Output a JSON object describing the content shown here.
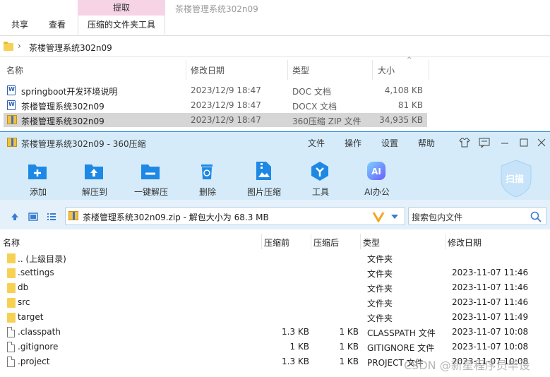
{
  "ribbon": {
    "contextual_tab": "提取",
    "tabs": [
      "共享",
      "查看",
      "压缩的文件夹工具"
    ],
    "window_title": "茶楼管理系统302n09"
  },
  "address": {
    "separator": "›",
    "path": "茶楼管理系统302n09"
  },
  "explorer": {
    "columns": [
      "名称",
      "修改日期",
      "类型",
      "大小"
    ],
    "files": [
      {
        "name": "springboot开发环境说明",
        "date": "2023/12/9 18:47",
        "type": "DOC 文档",
        "size": "4,108 KB",
        "icon": "word-doc-icon"
      },
      {
        "name": "茶楼管理系统302n09",
        "date": "2023/12/9 18:47",
        "type": "DOCX 文档",
        "size": "81 KB",
        "icon": "word-doc-icon"
      },
      {
        "name": "茶楼管理系统302n09",
        "date": "2023/12/9 18:47",
        "type": "360压缩 ZIP 文件",
        "size": "34,935 KB",
        "icon": "zip-icon"
      }
    ]
  },
  "zip": {
    "title": "茶楼管理系统302n09 - 360压缩",
    "menu": [
      "文件",
      "操作",
      "设置",
      "帮助"
    ],
    "tools": [
      {
        "label": "添加",
        "icon": "add-icon"
      },
      {
        "label": "解压到",
        "icon": "extract-to-icon"
      },
      {
        "label": "一键解压",
        "icon": "one-click-extract-icon"
      },
      {
        "label": "删除",
        "icon": "delete-icon"
      },
      {
        "label": "图片压缩",
        "icon": "image-compress-icon"
      },
      {
        "label": "工具",
        "icon": "tools-icon"
      },
      {
        "label": "AI办公",
        "icon": "ai-office-icon"
      }
    ],
    "scan_label": "扫描",
    "path_text": "茶楼管理系统302n09.zip - 解包大小为 68.3 MB",
    "search_placeholder": "搜索包内文件",
    "columns": [
      "名称",
      "压缩前",
      "压缩后",
      "类型",
      "修改日期"
    ],
    "rows": [
      {
        "name": ".. (上级目录)",
        "before": "",
        "after": "",
        "type": "文件夹",
        "date": "",
        "kind": "folder"
      },
      {
        "name": ".settings",
        "before": "",
        "after": "",
        "type": "文件夹",
        "date": "2023-11-07 11:46",
        "kind": "folder"
      },
      {
        "name": "db",
        "before": "",
        "after": "",
        "type": "文件夹",
        "date": "2023-11-07 11:46",
        "kind": "folder"
      },
      {
        "name": "src",
        "before": "",
        "after": "",
        "type": "文件夹",
        "date": "2023-11-07 11:46",
        "kind": "folder"
      },
      {
        "name": "target",
        "before": "",
        "after": "",
        "type": "文件夹",
        "date": "2023-11-07 11:49",
        "kind": "folder"
      },
      {
        "name": ".classpath",
        "before": "1.3 KB",
        "after": "1 KB",
        "type": "CLASSPATH 文件",
        "date": "2023-11-07 10:08",
        "kind": "file"
      },
      {
        "name": ".gitignore",
        "before": "1 KB",
        "after": "1 KB",
        "type": "GITIGNORE 文件",
        "date": "2023-11-07 10:08",
        "kind": "file"
      },
      {
        "name": ".project",
        "before": "1.3 KB",
        "after": "1 KB",
        "type": "PROJECT 文件",
        "date": "2023-11-07 10:08",
        "kind": "file"
      }
    ]
  },
  "watermark": "CSDN @新星程序员毕设",
  "colors": {
    "accent": "#1e88e5",
    "titlebar": "#d5ebfa",
    "pink_tab": "#f7d3e6"
  }
}
